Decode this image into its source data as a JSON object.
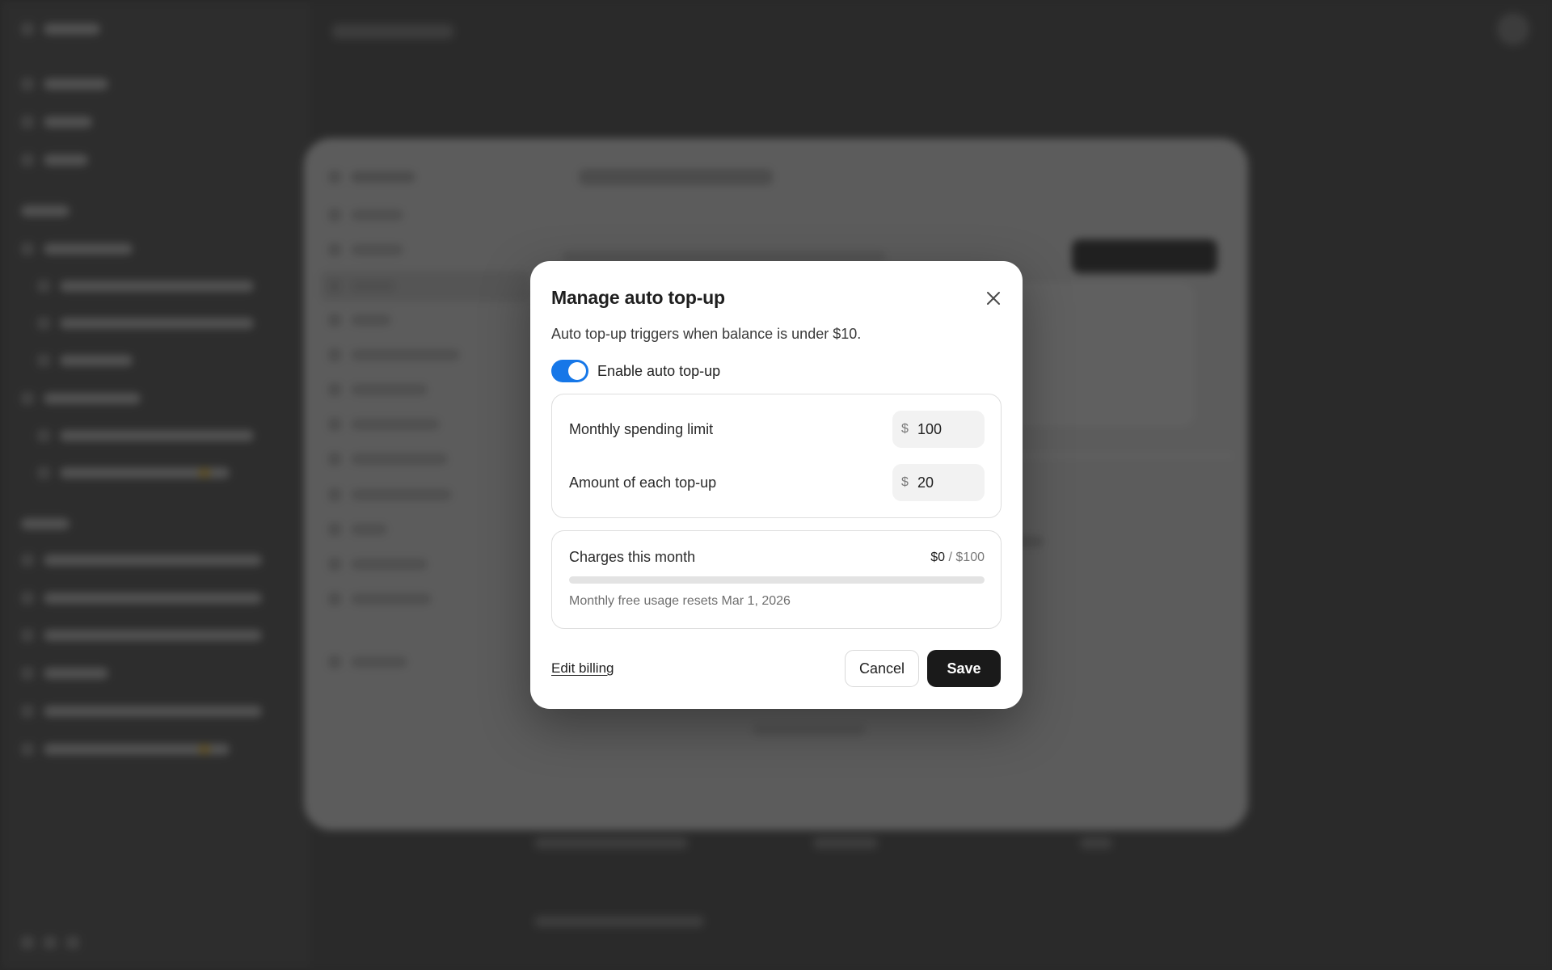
{
  "dialog": {
    "title": "Manage auto top-up",
    "close_icon": "close-icon",
    "subtitle": "Auto top-up triggers when balance is under $10.",
    "toggle": {
      "label": "Enable auto top-up",
      "enabled": true,
      "accent": "#1677e8"
    },
    "monthly_limit": {
      "label": "Monthly spending limit",
      "currency": "$",
      "value": "100"
    },
    "topup_amount": {
      "label": "Amount of each top-up",
      "currency": "$",
      "value": "20"
    },
    "charges": {
      "label": "Charges this month",
      "current": "$0",
      "separator": " / ",
      "limit": "$100",
      "progress_fraction": 0,
      "note": "Monthly free usage resets Mar 1, 2026"
    },
    "edit_billing": "Edit billing",
    "cancel": "Cancel",
    "save": "Save"
  }
}
